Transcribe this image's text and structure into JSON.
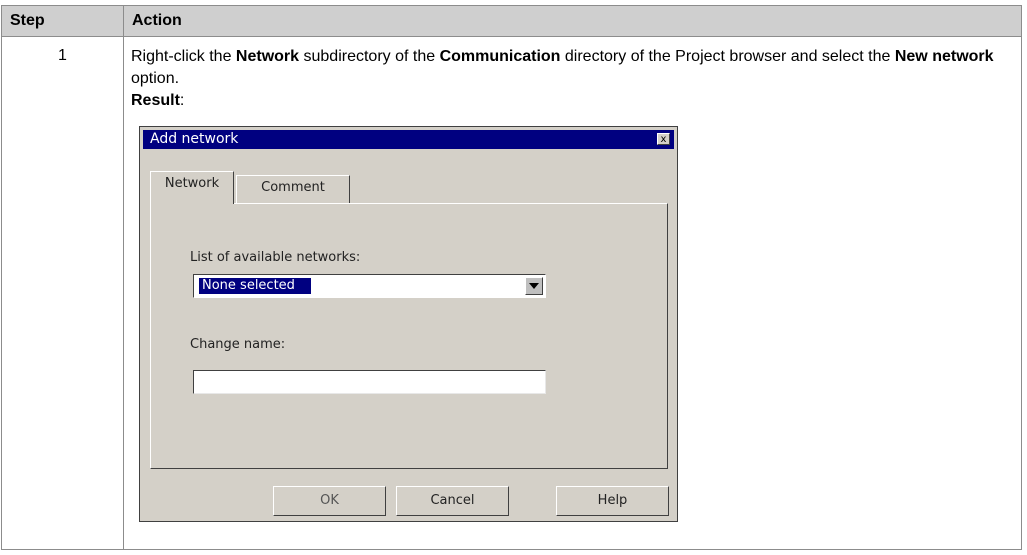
{
  "table": {
    "headers": [
      "Step",
      "Action"
    ],
    "row": {
      "step": "1",
      "action_parts": [
        "Right-click the ",
        "Network",
        " subdirectory of the ",
        "Communication",
        " directory of the Project browser and select the ",
        "New network",
        " option."
      ],
      "result_label": "Result",
      "result_colon": ":"
    }
  },
  "dialog": {
    "title": "Add network",
    "close_glyph": "x",
    "tabs": [
      "Network",
      "Comment"
    ],
    "list_label": "List of available networks:",
    "selected_network": "None selected",
    "name_label": "Change name:",
    "name_value": "",
    "buttons": {
      "ok": "OK",
      "cancel": "Cancel",
      "help": "Help"
    }
  }
}
